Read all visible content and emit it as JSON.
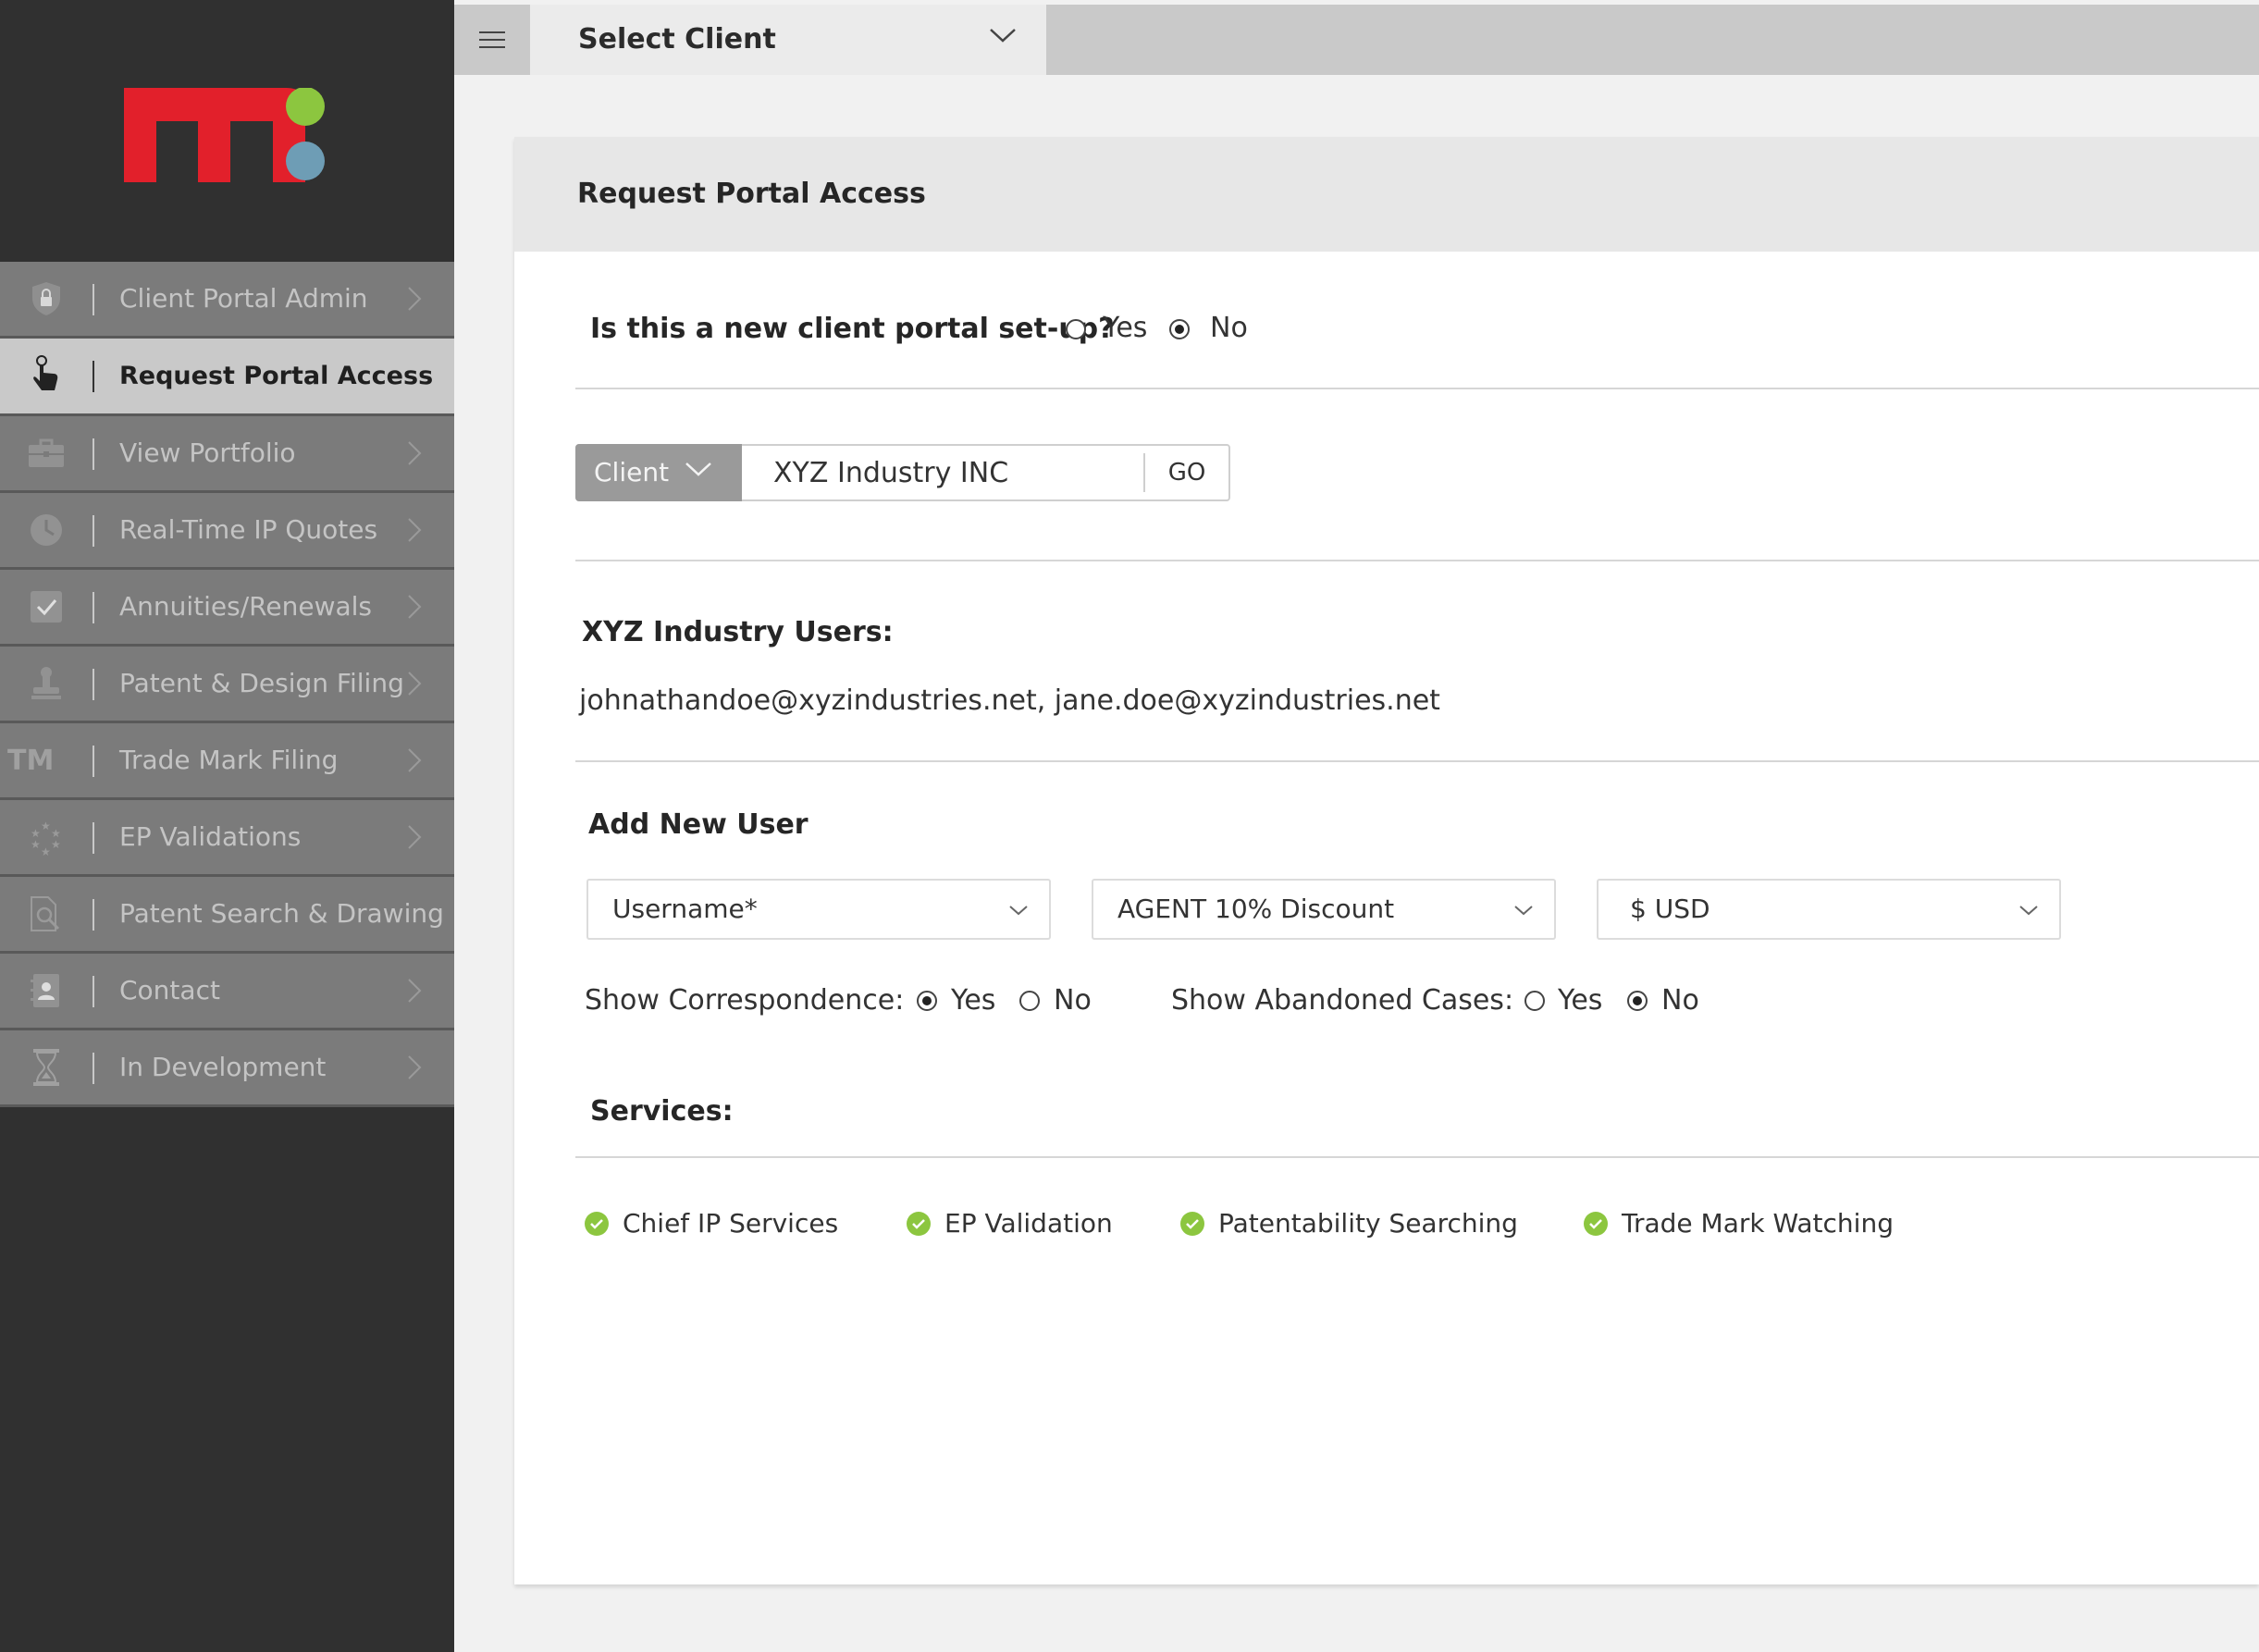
{
  "sidebar": {
    "logo": {
      "text": "m",
      "dot_top_color": "#8cc63f",
      "dot_bottom_color": "#6e9db5",
      "letter_color": "#e2202b"
    },
    "items": [
      {
        "label": "Client Portal Admin",
        "icon": "shield-lock-icon",
        "active": false
      },
      {
        "label": "Request Portal Access",
        "icon": "hand-pointer-icon",
        "active": true
      },
      {
        "label": "View Portfolio",
        "icon": "briefcase-icon",
        "active": false
      },
      {
        "label": "Real-Time IP Quotes",
        "icon": "clock-icon",
        "active": false
      },
      {
        "label": "Annuities/Renewals",
        "icon": "checkbox-icon",
        "active": false
      },
      {
        "label": "Patent & Design Filing",
        "icon": "stamp-icon",
        "active": false
      },
      {
        "label": "Trade Mark Filing",
        "icon": "tm-icon",
        "icon_text": "TM",
        "active": false
      },
      {
        "label": "EP Validations",
        "icon": "eu-stars-icon",
        "active": false
      },
      {
        "label": "Patent Search & Drawing",
        "icon": "document-search-icon",
        "active": false
      },
      {
        "label": "Contact",
        "icon": "contact-card-icon",
        "active": false
      },
      {
        "label": "In Development",
        "icon": "hourglass-icon",
        "active": false
      }
    ]
  },
  "topbar": {
    "menu_icon": "hamburger-icon",
    "client_select": "Select Client"
  },
  "panel": {
    "title": "Request Portal Access",
    "new_setup": {
      "question": "Is this a new client portal set-up?",
      "options": [
        "Yes",
        "No"
      ],
      "selected": "No"
    },
    "client_search": {
      "type_label": "Client",
      "value": "XYZ Industry INC",
      "go_label": "GO"
    },
    "users": {
      "heading": "XYZ Industry Users:",
      "list": "johnathandoe@xyzindustries.net, jane.doe@xyzindustries.net"
    },
    "add_user": {
      "heading": "Add New User",
      "username_placeholder": "Username*",
      "discount": "AGENT 10% Discount",
      "currency": "$ USD",
      "show_correspondence": {
        "label": "Show Correspondence:",
        "options": [
          "Yes",
          "No"
        ],
        "selected": "Yes"
      },
      "show_abandoned": {
        "label": "Show Abandoned Cases:",
        "options": [
          "Yes",
          "No"
        ],
        "selected": "No"
      }
    },
    "services": {
      "heading": "Services:",
      "items": [
        "Chief IP Services",
        "EP Validation",
        "Patentability Searching",
        "Trade Mark Watching"
      ],
      "check_color": "#8cc63f"
    }
  }
}
